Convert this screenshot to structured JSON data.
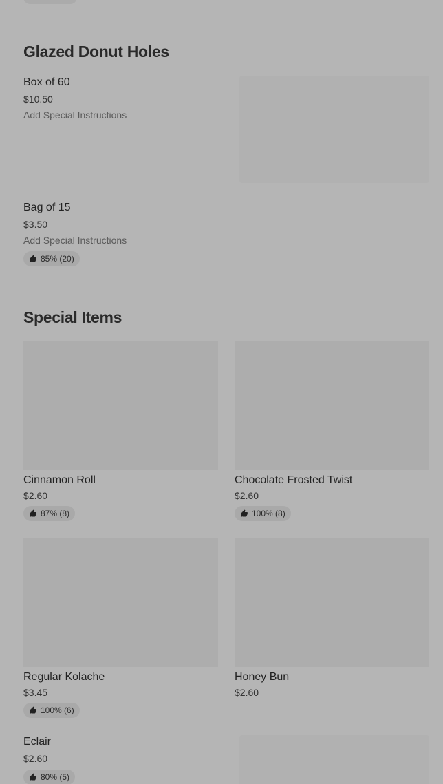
{
  "sections": {
    "glazed": {
      "title": "Glazed Donut Holes",
      "items": [
        {
          "name": "Box of 60",
          "price": "$10.50",
          "instructions": "Add Special Instructions"
        },
        {
          "name": "Bag of 15",
          "price": "$3.50",
          "instructions": "Add Special Instructions",
          "rating": "85% (20)"
        }
      ]
    },
    "special": {
      "title": "Special Items",
      "cards": [
        {
          "name": "Cinnamon Roll",
          "price": "$2.60",
          "rating": "87% (8)"
        },
        {
          "name": "Chocolate Frosted Twist",
          "price": "$2.60",
          "rating": "100% (8)"
        },
        {
          "name": "Regular Kolache",
          "price": "$3.45",
          "rating": "100% (6)"
        },
        {
          "name": "Honey Bun",
          "price": "$2.60"
        }
      ],
      "list_item": {
        "name": "Eclair",
        "price": "$2.60",
        "rating": "80% (5)"
      }
    }
  },
  "icons": {
    "rating": "thumbs-up-icon"
  }
}
